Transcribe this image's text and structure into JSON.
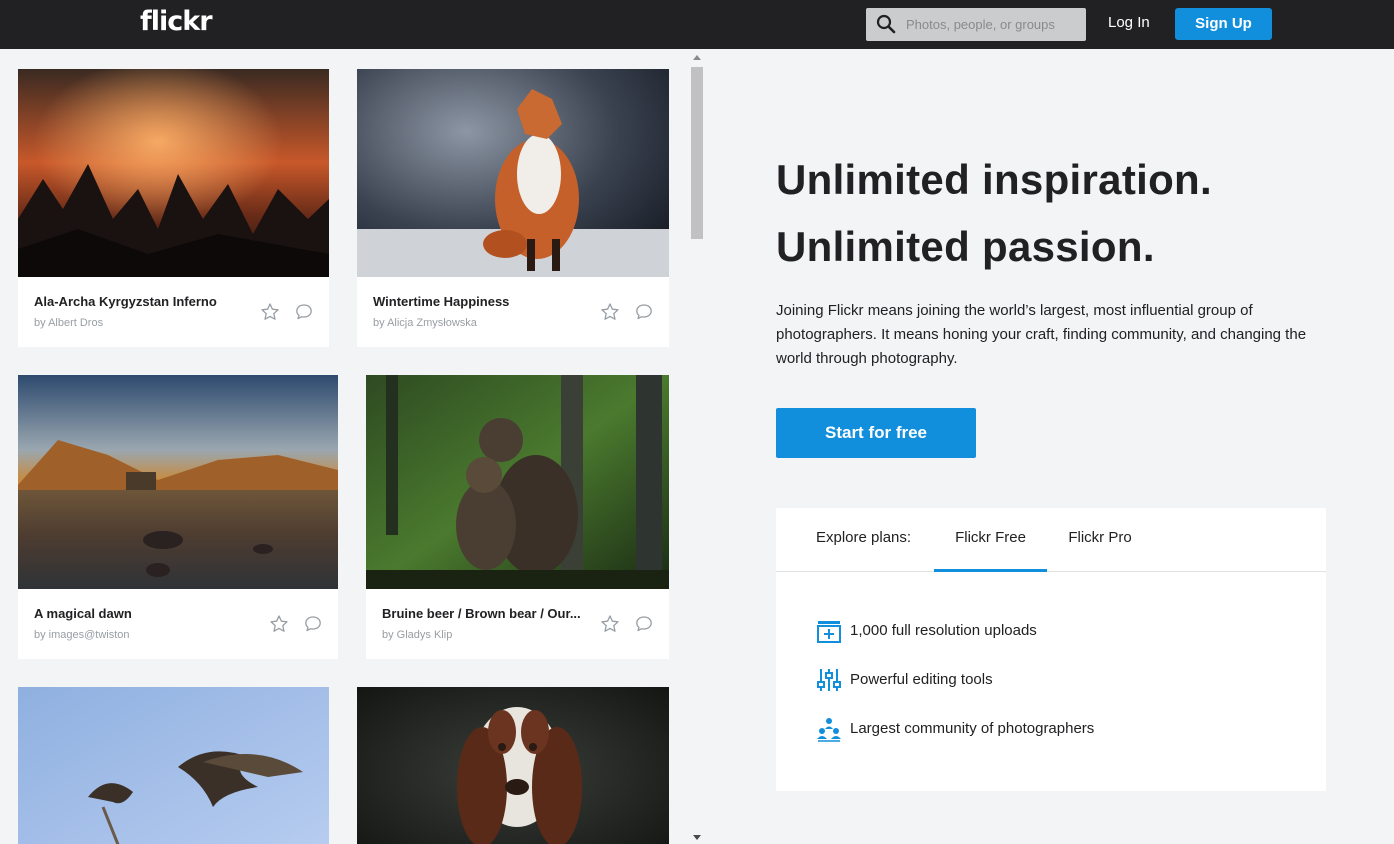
{
  "header": {
    "logo": "flickr",
    "search_placeholder": "Photos, people, or groups",
    "login_label": "Log In",
    "signup_label": "Sign Up"
  },
  "feed": {
    "cards": [
      {
        "title": "Ala-Archa Kyrgyzstan Inferno",
        "author": "by Albert Dros"
      },
      {
        "title": "Wintertime Happiness",
        "author": "by Alicja Zmysłowska"
      },
      {
        "title": "A magical dawn",
        "author": "by images@twiston"
      },
      {
        "title": "Bruine beer / Brown bear / Our...",
        "author": "by Gladys Klip"
      }
    ]
  },
  "hero": {
    "headline_1": "Unlimited inspiration.",
    "headline_2": "Unlimited passion.",
    "intro": "Joining Flickr means joining the world’s largest, most influential group of photographers. It means honing your craft, finding community, and changing the world through photography.",
    "cta_label": "Start for free"
  },
  "plans": {
    "label": "Explore plans:",
    "tabs": [
      {
        "label": "Flickr Free",
        "active": true
      },
      {
        "label": "Flickr Pro",
        "active": false
      }
    ],
    "features": [
      {
        "icon": "upload-icon",
        "label": "1,000 full resolution uploads"
      },
      {
        "icon": "sliders-icon",
        "label": "Powerful editing tools"
      },
      {
        "icon": "community-icon",
        "label": "Largest community of photographers"
      }
    ]
  },
  "colors": {
    "header_bg": "#212124",
    "accent": "#128fdc",
    "page_bg": "#f3f4f6"
  }
}
